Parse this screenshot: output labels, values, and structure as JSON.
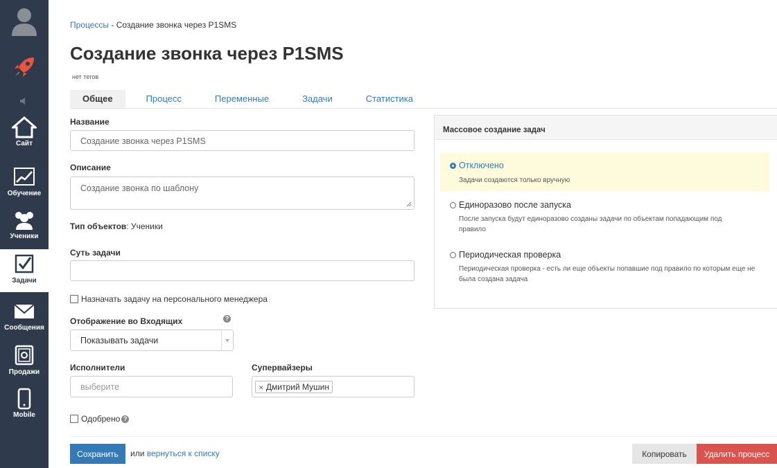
{
  "sidebar": {
    "items": [
      {
        "label": "Сайт"
      },
      {
        "label": "Обучение"
      },
      {
        "label": "Ученики"
      },
      {
        "label": "Задачи"
      },
      {
        "label": "Сообщения"
      },
      {
        "label": "Продажи"
      },
      {
        "label": "Mobile"
      }
    ]
  },
  "breadcrumb": {
    "parent": "Процессы",
    "separator": " - ",
    "current": "Создание звонка через P1SMS"
  },
  "page": {
    "title": "Создание звонка через P1SMS",
    "tags": "нет тегов"
  },
  "tabs": [
    {
      "label": "Общее",
      "active": true
    },
    {
      "label": "Процесс"
    },
    {
      "label": "Переменные"
    },
    {
      "label": "Задачи"
    },
    {
      "label": "Статистика"
    }
  ],
  "form": {
    "name_label": "Название",
    "name_value": "Создание звонка через P1SMS",
    "description_label": "Описание",
    "description_value": "Создание звонка по шаблону",
    "object_type_label": "Тип объектов",
    "object_type_value": ": Ученики",
    "task_essence_label": "Суть задачи",
    "task_essence_value": "",
    "assign_manager_label": "Назначать задачу на персонального менеджера",
    "inbox_label": "Отображение во Входящих",
    "inbox_value": "Показывать задачи",
    "executors_label": "Исполнители",
    "executors_placeholder": "выберите",
    "supervisors_label": "Супервайзеры",
    "supervisor_tag": "Дмитрий Мушин",
    "approved_label": "Одобрено"
  },
  "mass_panel": {
    "title": "Массовое создание задач",
    "options": [
      {
        "title": "Отключено",
        "desc": "Задачи создаются только вручную",
        "selected": true
      },
      {
        "title": "Единоразово после запуска",
        "desc": "После запуска будут единоразово созданы задачи по объектам попадающим под правило"
      },
      {
        "title": "Периодическая проверка",
        "desc": "Периодическая проверка - есть ли еще объекты попавшие под правило по которым еще не была создана задача"
      }
    ]
  },
  "footer": {
    "save_label": "Сохранить",
    "or_text": "или",
    "back_link": "вернуться к списку",
    "copy_label": "Копировать",
    "delete_label": "Удалить процесс"
  },
  "colors": {
    "sidebar": "#2f3b4c",
    "accent": "#337ab7",
    "danger": "#d9534f",
    "highlight": "#fdfbdc"
  }
}
